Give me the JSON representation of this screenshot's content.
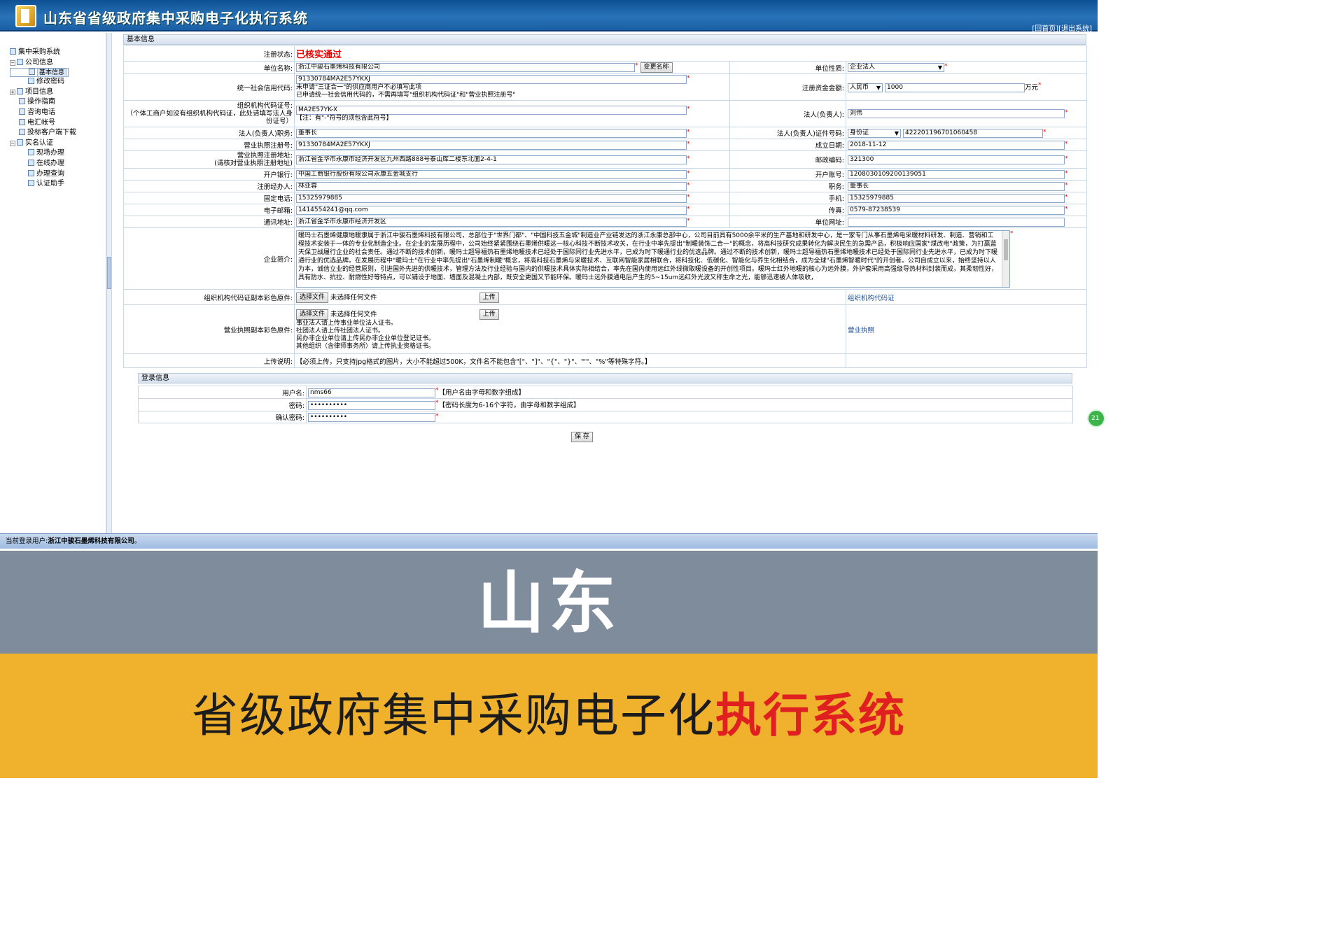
{
  "app": {
    "title": "山东省省级政府集中采购电子化执行系统",
    "links": {
      "home": "[回首页]",
      "logout": "[退出系统]"
    }
  },
  "sidebar": {
    "items": [
      {
        "label": "集中采购系统"
      },
      {
        "label": "公司信息"
      },
      {
        "label": "基本信息"
      },
      {
        "label": "修改密码"
      },
      {
        "label": "项目信息"
      },
      {
        "label": "操作指南"
      },
      {
        "label": "咨询电话"
      },
      {
        "label": "电汇帐号"
      },
      {
        "label": "投标客户端下载"
      },
      {
        "label": "实名认证"
      },
      {
        "label": "现场办理"
      },
      {
        "label": "在线办理"
      },
      {
        "label": "办理查询"
      },
      {
        "label": "认证助手"
      }
    ]
  },
  "basic": {
    "section_title": "基本信息",
    "status_label": "注册状态:",
    "status_value": "已核实通过",
    "unit_name_label": "单位名称:",
    "unit_name_value": "浙江中骏石墨烯科技有限公司",
    "change_name_button": "变更名称",
    "unit_type_label": "单位性质:",
    "unit_type_value": "企业法人",
    "credit_code_label": "统一社会信用代码:",
    "credit_code_value": "91330784MA2E57YKXJ",
    "credit_note1": "未申请\"三证合一\"的供应商用户不必填写此项",
    "credit_note2": "已申请统一社会信用代码的，不需再填写\"组织机构代码证\"和\"营业执照注册号\"",
    "capital_label": "注册资金金额:",
    "capital_currency": "人民币",
    "capital_value": "1000",
    "capital_unit": "万元",
    "org_code_label1": "组织机构代码证号:",
    "org_code_label2": "（个体工商户如没有组织机构代码证，此处请填写法人身份证号）",
    "org_code_value": "MA2E57YK-X",
    "org_code_note": "【注：有\"-\"符号的须包含此符号】",
    "legal_person_label": "法人(负责人):",
    "legal_person_value": "刘伟",
    "legal_title_label": "法人(负责人)职务:",
    "legal_title_value": "董事长",
    "legal_id_label": "法人(负责人)证件号码:",
    "legal_id_type": "身份证",
    "legal_id_value": "422201196701060458",
    "license_no_label": "营业执照注册号:",
    "license_no_value": "91330784MA2E57YKXJ",
    "founded_label": "成立日期:",
    "founded_value": "2018-11-12",
    "license_addr_label1": "营业执照注册地址:",
    "license_addr_label2": "(请核对营业执照注册地址)",
    "license_addr_value": "浙江省金华市永康市经济开发区九州西路888号泰山库二楼东北面2-4-1",
    "postcode_label": "邮政编码:",
    "postcode_value": "321300",
    "bank_label": "开户银行:",
    "bank_value": "中国工商银行股份有限公司永康五金城支行",
    "account_label": "开户账号:",
    "account_value": "1208030109200139051",
    "agent_label": "注册经办人:",
    "agent_value": "林亚蓉",
    "agent_title_label": "职务:",
    "agent_title_value": "董事长",
    "phone_label": "固定电话:",
    "phone_value": "15325979885",
    "mobile_label": "手机:",
    "mobile_value": "15325979885",
    "email_label": "电子邮箱:",
    "email_value": "1414554241@qq.com",
    "fax_label": "传真:",
    "fax_value": "0579-87238539",
    "address_label": "通讯地址:",
    "address_value": "浙江省金华市永康市经济开发区",
    "website_label": "单位网址:",
    "website_value": "",
    "intro_label": "企业简介:",
    "intro_text": "暖玛士石墨烯健康地暖隶属于浙江中骏石墨烯科技有限公司，总部位于\"世界门都\"、\"中国科技五金城\"制造业产业链发达的浙江永康总部中心，公司目前具有5000余平米的生产基地和研发中心，是一家专门从事石墨烯电采暖材料研发、制造、营销和工程技术安装于一体的专业化制造企业。在企业的发展历程中，公司始终紧紧围绕石墨烯供暖这一核心科技不断技术攻关，在行业中率先提出\"制暖装饰二合一\"的概念，将高科技研究成果转化为解决民生的急需产品，积极响应国家\"煤改电\"政策，为打赢蓝天保卫战履行企业的社会责任。通过不断的技术创新，暖玛士超导福热石墨烯地暖技术已经处于国际同行业先进水平，已成为时下暖通行业的优选品牌。通过不断的技术创新，暖玛士超导福热石墨烯地暖技术已经处于国际同行业先进水平，已成为时下暖通行业的优选品牌。在发展历程中\"暖玛士\"在行业中率先提出\"石墨烯制暖\"概念，将高科技石墨烯与采暖技术、互联网智能家居相联合，将科技化、低碳化、智能化与养生化相结合，成为全球\"石墨烯智暖时代\"的开创者。公司自成立以来，始终坚持以人为本，诚信立业的经营原则，引进国外先进的供暖技术，管理方法及行业经验与国内的供暖技术具体实际相结合，率先在国内使用远红外线微取暖设备的开创性项目。暖玛士红外地暖的核心为远外膜，外护套采用高强级导热材料封装而成，其柔韧性好，具有防水、抗拉、耐燃性好等特点，可以铺设于地面、墙面及混凝土内部，既安全更国又节能环保。暖玛士远外膜通电后产生的5~15um远红外光波又称生命之光，能够迅速被人体吸收，",
    "org_file_label": "组织机构代码证副本彩色原件:",
    "choose_file_button": "选择文件",
    "no_file": "未选择任何文件",
    "upload_button": "上传",
    "org_file_link": "组织机构代码证",
    "license_file_label": "营业执照副本彩色原件:",
    "license_notes": [
      "事业法人请上传事业单位法人证书。",
      "社团法人请上传社团法人证书。",
      "民办非企业单位请上传民办非企业单位登记证书。",
      "其他组织（含律师事务所）请上传执业资格证书。"
    ],
    "license_file_link": "营业执照",
    "upload_note_label": "上传说明:",
    "upload_note_value": "【必须上传，只支持jpg格式的图片，大小不能超过500K，文件名不能包含\"[\"、\"]\"、\"{\"、\"}\"、\"'\"、\"%\"等特殊字符。】"
  },
  "login": {
    "section_title": "登录信息",
    "username_label": "用户名:",
    "username_value": "nms66",
    "username_note": "【用户名由字母和数字组成】",
    "password_label": "密码:",
    "password_value": "••••••••••",
    "password_note": "【密码长度为6-16个字符，由字母和数字组成】",
    "confirm_label": "确认密码:",
    "confirm_value": "••••••••••",
    "save_button": "保 存"
  },
  "statusbar": {
    "prefix": "当前登录用户:",
    "user": "浙江中骏石墨烯科技有限公司",
    "suffix": "。"
  },
  "badge": {
    "text": "21"
  },
  "banner": {
    "city": "山东",
    "subtitle_black": "省级政府集中采购电子化",
    "subtitle_red": "执行系统"
  },
  "colors": {
    "accent": "#1a5fa3",
    "status": "#e00000",
    "banner_gray": "#7f8c9c",
    "banner_yellow": "#f0b12d"
  }
}
